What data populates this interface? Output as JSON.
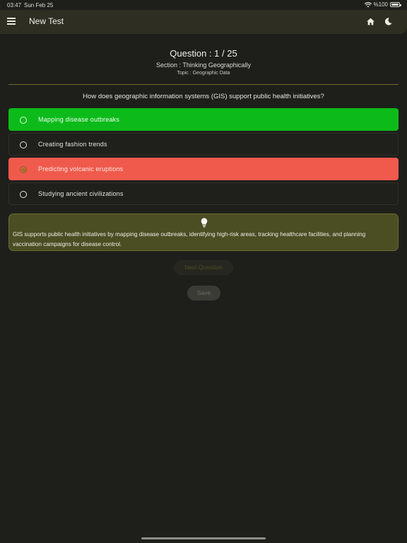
{
  "status_bar": {
    "time": "03:47",
    "date": "Sun Feb 25",
    "battery": "%100"
  },
  "app_bar": {
    "title": "New Test",
    "icons": [
      "menu-icon",
      "home-icon",
      "moon-icon"
    ]
  },
  "question": {
    "number": "Question : 1 / 25",
    "section": "Section : Thinking Geographically",
    "topic": "Topic : Geographic Data",
    "text": "How does geographic information systems (GIS) support public health initiatives?"
  },
  "options": [
    {
      "label": "Mapping disease outbreaks",
      "state": "correct"
    },
    {
      "label": "Creating fashion trends",
      "state": "default"
    },
    {
      "label": "Predicting volcanic eruptions",
      "state": "wrong-selected"
    },
    {
      "label": "Studying ancient civilizations",
      "state": "default"
    }
  ],
  "hint": {
    "icon": "lightbulb-icon",
    "text": "GIS supports public health initiatives by mapping disease outbreaks, identifying high-risk areas, tracking healthcare facilities, and planning vaccination campaigns for disease control."
  },
  "buttons": {
    "next": "Next Question",
    "save": "Save"
  },
  "colors": {
    "background": "#1e1f1b",
    "app_bar": "#2e2f22",
    "correct": "#0cbb1a",
    "wrong": "#ef5a4c",
    "hint_bg": "#4b4d23"
  }
}
